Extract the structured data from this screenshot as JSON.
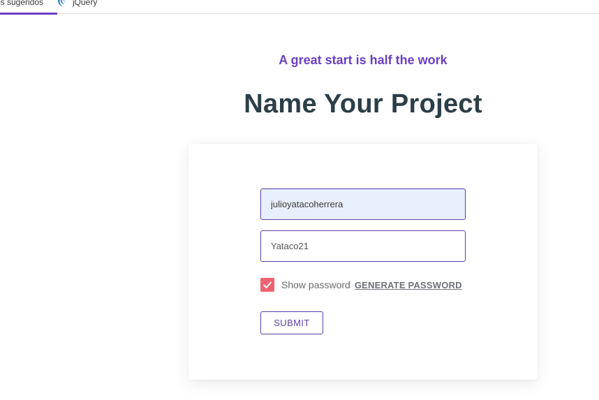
{
  "bookmarks_bar": {
    "items": [
      {
        "label": "os sugeridos",
        "icon": "none"
      },
      {
        "label": "jQuery",
        "icon": "jquery-logo-icon"
      }
    ],
    "active_color": "#6c3fc4"
  },
  "header": {
    "tagline": "A great start is half the work",
    "title": "Name Your Project"
  },
  "form": {
    "username_value": "julioyatacoherrera",
    "password_value": "Yataco21",
    "show_password_checked": true,
    "show_password_label": "Show password",
    "generate_label": "GENERATE PASSWORD",
    "submit_label": "SUBMIT"
  },
  "colors": {
    "accent": "#5b3fa8",
    "checkbox": "#f06373",
    "title": "#2c3e47",
    "autofill_bg": "#e8effd"
  }
}
